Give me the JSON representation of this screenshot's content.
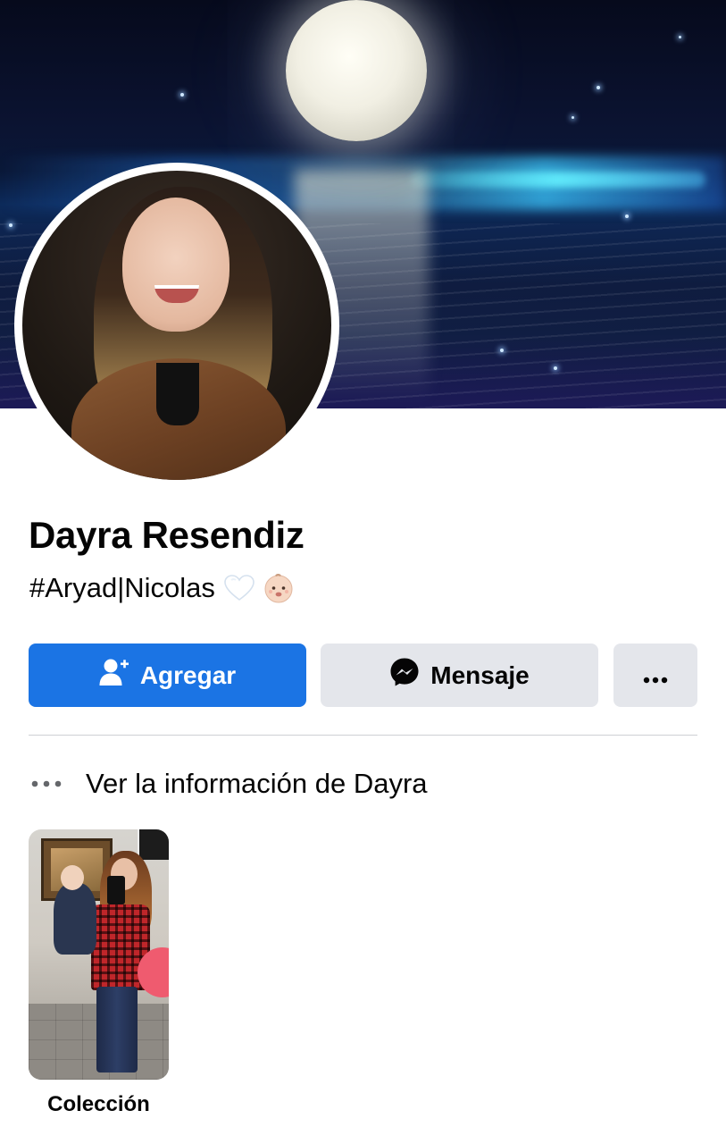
{
  "profile": {
    "name": "Dayra Resendiz",
    "bio_text": "#Aryad|Nicolas",
    "bio_emojis": [
      "white-heart-icon",
      "baby-face-icon"
    ]
  },
  "actions": {
    "add_label": "Agregar",
    "message_label": "Mensaje",
    "more_icon": "more-dots-icon"
  },
  "info": {
    "label": "Ver la información de Dayra"
  },
  "collections": [
    {
      "label": "Colección"
    }
  ],
  "colors": {
    "primary_blue": "#1b74e4",
    "secondary_button": "#e4e6eb",
    "text": "#050505",
    "divider": "#ced0d4"
  }
}
